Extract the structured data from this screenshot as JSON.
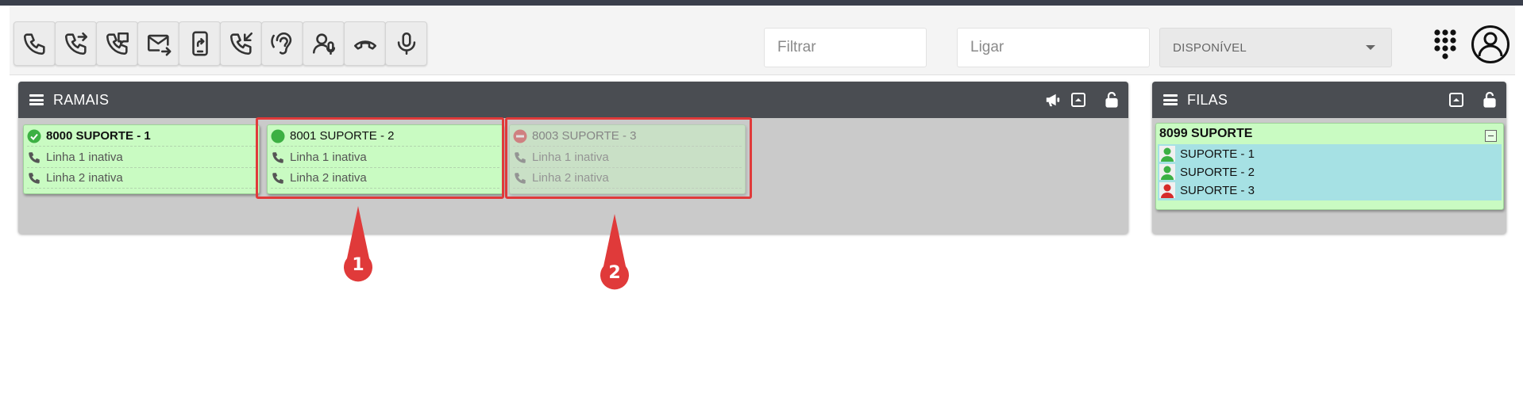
{
  "toolbar": {
    "buttons": [
      {
        "icon": "phone-icon",
        "name": "call"
      },
      {
        "icon": "phone-forward-icon",
        "name": "transfer"
      },
      {
        "icon": "phone-voicemail-icon",
        "name": "voicemail"
      },
      {
        "icon": "mail-forward-icon",
        "name": "mail-forward"
      },
      {
        "icon": "mobile-share-icon",
        "name": "mobile-transfer"
      },
      {
        "icon": "phone-incoming-icon",
        "name": "pickup"
      },
      {
        "icon": "ear-listen-icon",
        "name": "listen"
      },
      {
        "icon": "user-mic-icon",
        "name": "conference"
      },
      {
        "icon": "hang-up-icon",
        "name": "hang-up"
      },
      {
        "icon": "microphone-icon",
        "name": "microphone"
      }
    ],
    "filter_placeholder": "Filtrar",
    "dial_placeholder": "Ligar",
    "status_selected": "DISPONÍVEL"
  },
  "ramais": {
    "title": "RAMAIS",
    "extensions": [
      {
        "label": "8000 SUPORTE - 1",
        "status": "check-circle-icon",
        "line1": "Linha 1 inativa",
        "line2": "Linha 2 inativa"
      },
      {
        "label": "8001 SUPORTE - 2",
        "status": "online-dot-icon",
        "line1": "Linha 1 inativa",
        "line2": "Linha 2 inativa"
      },
      {
        "label": "8003 SUPORTE - 3",
        "status": "do-not-disturb-icon",
        "line1": "Linha 1 inativa",
        "line2": "Linha 2 inativa"
      }
    ]
  },
  "filas": {
    "title": "FILAS",
    "queue_label": "8099 SUPORTE",
    "members": [
      {
        "name": "SUPORTE - 1",
        "avatar_color": "#3cb043"
      },
      {
        "name": "SUPORTE - 2",
        "avatar_color": "#3cb043"
      },
      {
        "name": "SUPORTE - 3",
        "avatar_color": "#d62b2b"
      }
    ]
  },
  "annotations": [
    "1",
    "2"
  ],
  "colors": {
    "header": "#4a4d52",
    "card_bg": "#c9fbc2",
    "queue_members_bg": "#a6e1e4",
    "highlight": "#e03a3a"
  }
}
